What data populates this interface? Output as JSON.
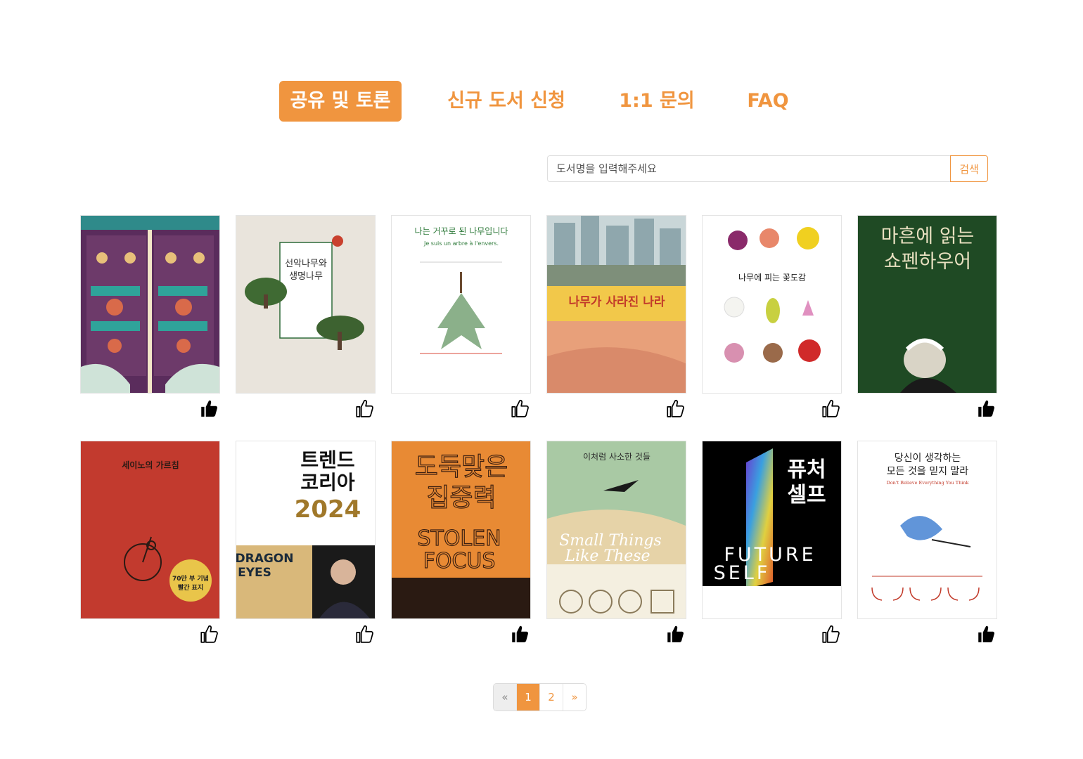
{
  "tabs": [
    {
      "label": "공유 및 토론",
      "active": true
    },
    {
      "label": "신규 도서 신청",
      "active": false
    },
    {
      "label": "1:1 문의",
      "active": false
    },
    {
      "label": "FAQ",
      "active": false
    }
  ],
  "search": {
    "placeholder": "도서명을 입력해주세요",
    "button_label": "검색"
  },
  "colors": {
    "accent": "#f0953f"
  },
  "books": [
    {
      "cover": "illustrated-bookshelf-art",
      "cover_text": [],
      "liked": true
    },
    {
      "cover": "두 나무 그림",
      "cover_text": [
        "선악나무와",
        "생명나무"
      ],
      "liked": false
    },
    {
      "cover": "나무 일러스트",
      "cover_text": [
        "나는 거꾸로 된 나무입니다",
        "Je suis un arbre à l'envers."
      ],
      "liked": false
    },
    {
      "cover": "도시 그림",
      "cover_text": [
        "나무가 사라진 나라"
      ],
      "liked": false
    },
    {
      "cover": "꽃 일러스트",
      "cover_text": [
        "나무에 피는 꽃도감"
      ],
      "liked": false
    },
    {
      "cover": "초상화",
      "cover_text": [
        "마흔에 읽는",
        "쇼펜하우어"
      ],
      "liked": true
    },
    {
      "cover": "자전거 그림",
      "cover_text": [
        "세이노의 가르침",
        "70만 부 기념",
        "빨간 표지"
      ],
      "liked": false
    },
    {
      "cover": "인물 사진",
      "cover_text": [
        "트렌드",
        "코리아",
        "2024",
        "DRAGON",
        "EYES"
      ],
      "liked": false
    },
    {
      "cover": "타이포 표지",
      "cover_text": [
        "도둑맞은",
        "집중력",
        "STOLEN",
        "FOCUS"
      ],
      "liked": true
    },
    {
      "cover": "풍경 그림",
      "cover_text": [
        "이처럼 사소한 것들",
        "Small Things",
        "Like These"
      ],
      "liked": true
    },
    {
      "cover": "그라데이션",
      "cover_text": [
        "퓨처",
        "셀프",
        "FUTURE",
        "SELF"
      ],
      "liked": false
    },
    {
      "cover": "잉크 그림",
      "cover_text": [
        "당신이 생각하는",
        "모든 것을 믿지 말라",
        "Don't Believe Everything You Think"
      ],
      "liked": true
    }
  ],
  "pagination": {
    "prev": "«",
    "pages": [
      "1",
      "2"
    ],
    "current": "1",
    "next": "»"
  }
}
